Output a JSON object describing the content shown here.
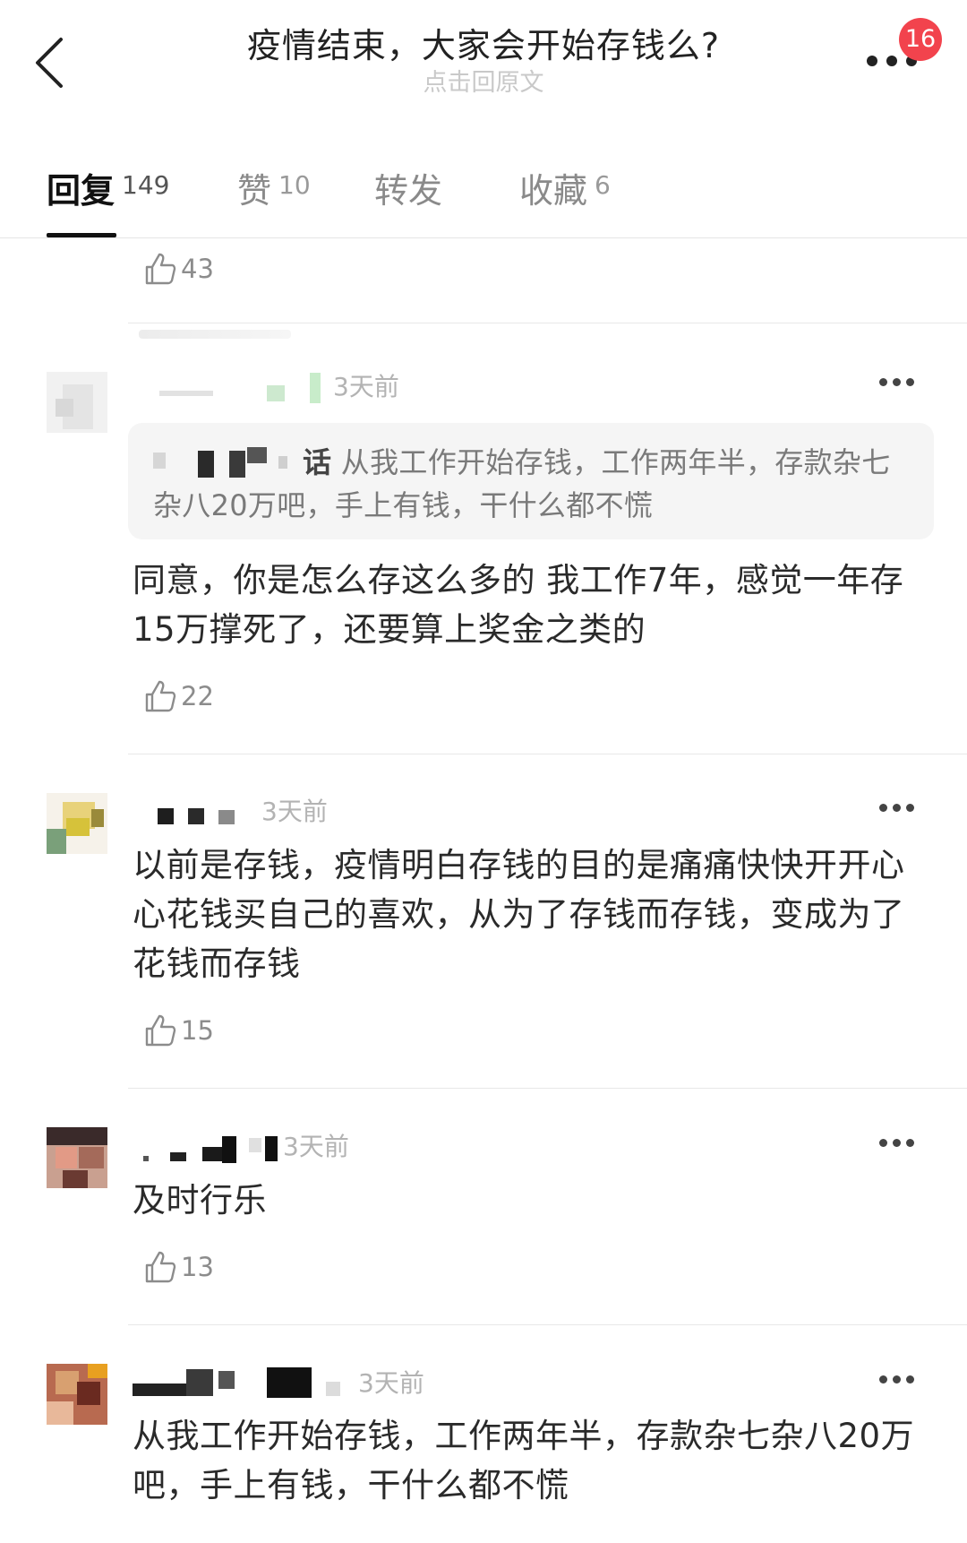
{
  "header": {
    "title": "疫情结束，大家会开始存钱么?",
    "subtitle": "点击回原文",
    "notification_count": "16"
  },
  "tabs": [
    {
      "label": "回复",
      "count": "149",
      "active": true
    },
    {
      "label": "赞",
      "count": "10",
      "active": false
    },
    {
      "label": "转发",
      "count": "",
      "active": false
    },
    {
      "label": "收藏",
      "count": "6",
      "active": false
    }
  ],
  "prev_comment": {
    "likes": "43"
  },
  "comments": [
    {
      "time": "3天前",
      "quote": {
        "name": "话",
        "text": "从我工作开始存钱，工作两年半，存款杂七杂八20万吧，手上有钱，干什么都不慌"
      },
      "text": "同意，你是怎么存这么多的 我工作7年，感觉一年存15万撑死了，还要算上奖金之类的",
      "likes": "22"
    },
    {
      "time": "3天前",
      "text": "以前是存钱，疫情明白存钱的目的是痛痛快快开开心心花钱买自己的喜欢，从为了存钱而存钱，变成为了花钱而存钱",
      "likes": "15"
    },
    {
      "time": "3天前",
      "text": "及时行乐",
      "likes": "13"
    },
    {
      "time": "3天前",
      "text": "从我工作开始存钱，工作两年半，存款杂七杂八20万吧，手上有钱，干什么都不慌",
      "likes": ""
    }
  ],
  "colors": {
    "badge": "#f2434d",
    "text": "#2a2a2a",
    "muted": "#b3b3b3",
    "quote_bg": "#f5f5f5",
    "tab_active": "#111111"
  },
  "icons": {
    "back": "chevron-left-icon",
    "more": "more-dots-icon",
    "like": "thumbs-up-outline-icon"
  }
}
